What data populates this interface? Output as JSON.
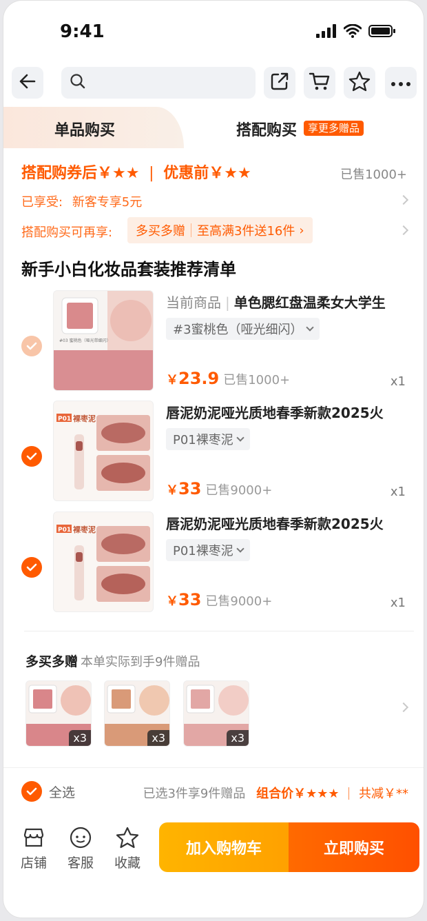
{
  "status_bar": {
    "time": "9:41"
  },
  "tabs": {
    "single": "单品购买",
    "bundle": "搭配购买",
    "bundle_badge": "享更多赠品"
  },
  "price_header": {
    "after_coupon": "搭配购券后￥★★",
    "separator": "|",
    "before": "优惠前￥★★",
    "sold": "已售1000+"
  },
  "enjoyed": {
    "label": "已享受:",
    "value": "新客专享5元"
  },
  "extra": {
    "label": "搭配购买可再享:",
    "pill_a": "多买多赠",
    "pill_b": "至高满3件送16件",
    "pill_arrow": "›"
  },
  "section_title": "新手小白化妆品套装推荐清单",
  "items": [
    {
      "prefix": "当前商品",
      "title": "单色腮红盘温柔女大学生",
      "variant": "#3蜜桃色（哑光细闪）",
      "price_symbol": "￥",
      "price": "23.9",
      "sold": "已售1000+",
      "qty": "x1",
      "checked": "light",
      "thumb_label": "#03 蜜桃色（哑光带细闪）"
    },
    {
      "prefix": "",
      "title": "唇泥奶泥哑光质地春季新款2025火",
      "variant": "P01裸枣泥",
      "price_symbol": "￥",
      "price": "33",
      "sold": "已售9000+",
      "qty": "x1",
      "checked": "on",
      "thumb_tag": "P01",
      "thumb_name": "裸枣泥"
    },
    {
      "prefix": "",
      "title": "唇泥奶泥哑光质地春季新款2025火",
      "variant": "P01裸枣泥",
      "price_symbol": "￥",
      "price": "33",
      "sold": "已售9000+",
      "qty": "x1",
      "checked": "on",
      "thumb_tag": "P01",
      "thumb_name": "裸枣泥"
    }
  ],
  "gifts": {
    "title": "多买多赠",
    "subtitle": "本单实际到手9件赠品",
    "items": [
      {
        "qty": "x3",
        "color": "#d9868a"
      },
      {
        "qty": "x3",
        "color": "#d99a78"
      },
      {
        "qty": "x3",
        "color": "#e2a7a5"
      }
    ]
  },
  "bottom": {
    "select_all": "全选",
    "selected_info": "已选3件享9件赠品",
    "combo_price": "组合价￥★★★",
    "saving": "共减￥**"
  },
  "toolbar": {
    "store": "店铺",
    "service": "客服",
    "favorite": "收藏",
    "add_cart": "加入购物车",
    "buy_now": "立即购买"
  },
  "colors": {
    "accent": "#ff5a00",
    "cart_button": "#ffae00"
  }
}
